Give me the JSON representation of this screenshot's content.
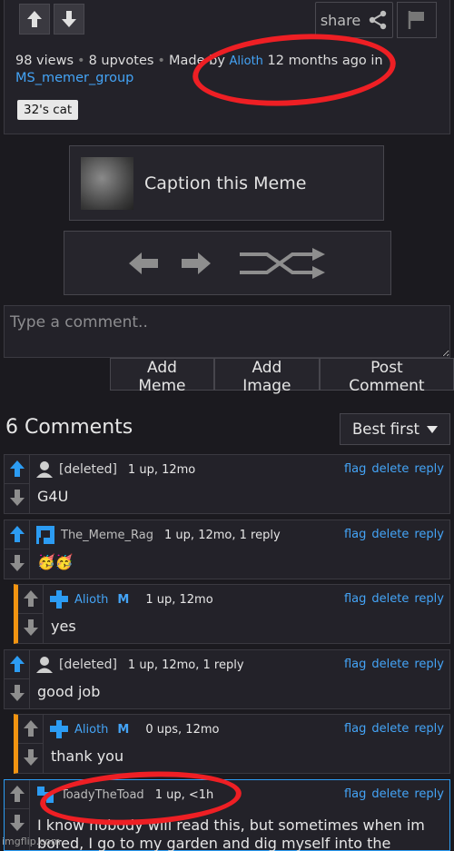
{
  "post": {
    "share_label": "share",
    "views": "98 views",
    "upvotes": "8 upvotes",
    "made_by_prefix": "Made by",
    "author": "Alioth",
    "time_ago": "12 months ago in",
    "group": "MS_memer_group",
    "tag": "32's cat"
  },
  "caption": {
    "label": "Caption this Meme"
  },
  "comment_box": {
    "placeholder": "Type a comment..",
    "buttons": [
      "Add Meme",
      "Add Image",
      "Post Comment"
    ]
  },
  "comments_header": {
    "title": "6 Comments",
    "sort": "Best first"
  },
  "comment_actions": {
    "flag": "flag",
    "delete": "delete",
    "reply": "reply"
  },
  "comments": [
    {
      "user": "[deleted]",
      "meta": "1 up, 12mo",
      "text": "G4U",
      "upvoted": true
    },
    {
      "user": "The_Meme_Rag",
      "meta": "1 up, 12mo, 1 reply",
      "text": "🥳🥳",
      "upvoted": true
    },
    {
      "user": "Alioth",
      "mod": "M",
      "meta": "1 up, 12mo",
      "text": "yes",
      "upvoted": false
    },
    {
      "user": "[deleted]",
      "meta": "1 up, 12mo, 1 reply",
      "text": "good job",
      "upvoted": true
    },
    {
      "user": "Alioth",
      "mod": "M",
      "meta": "0 ups, 12mo",
      "text": "thank you",
      "upvoted": false
    },
    {
      "user": "ToadyTheToad",
      "meta": "1 up, <1h",
      "text": "I know nobody will read this, but sometimes when im bored, I go to my garden and dig myself into the",
      "upvoted": false
    }
  ],
  "watermark": "imgflip.com",
  "colors": {
    "accent_blue": "#44a4f6",
    "reply_bar": "#f29411",
    "annotation_red": "#ee1f24",
    "background": "#1b1a1f"
  }
}
